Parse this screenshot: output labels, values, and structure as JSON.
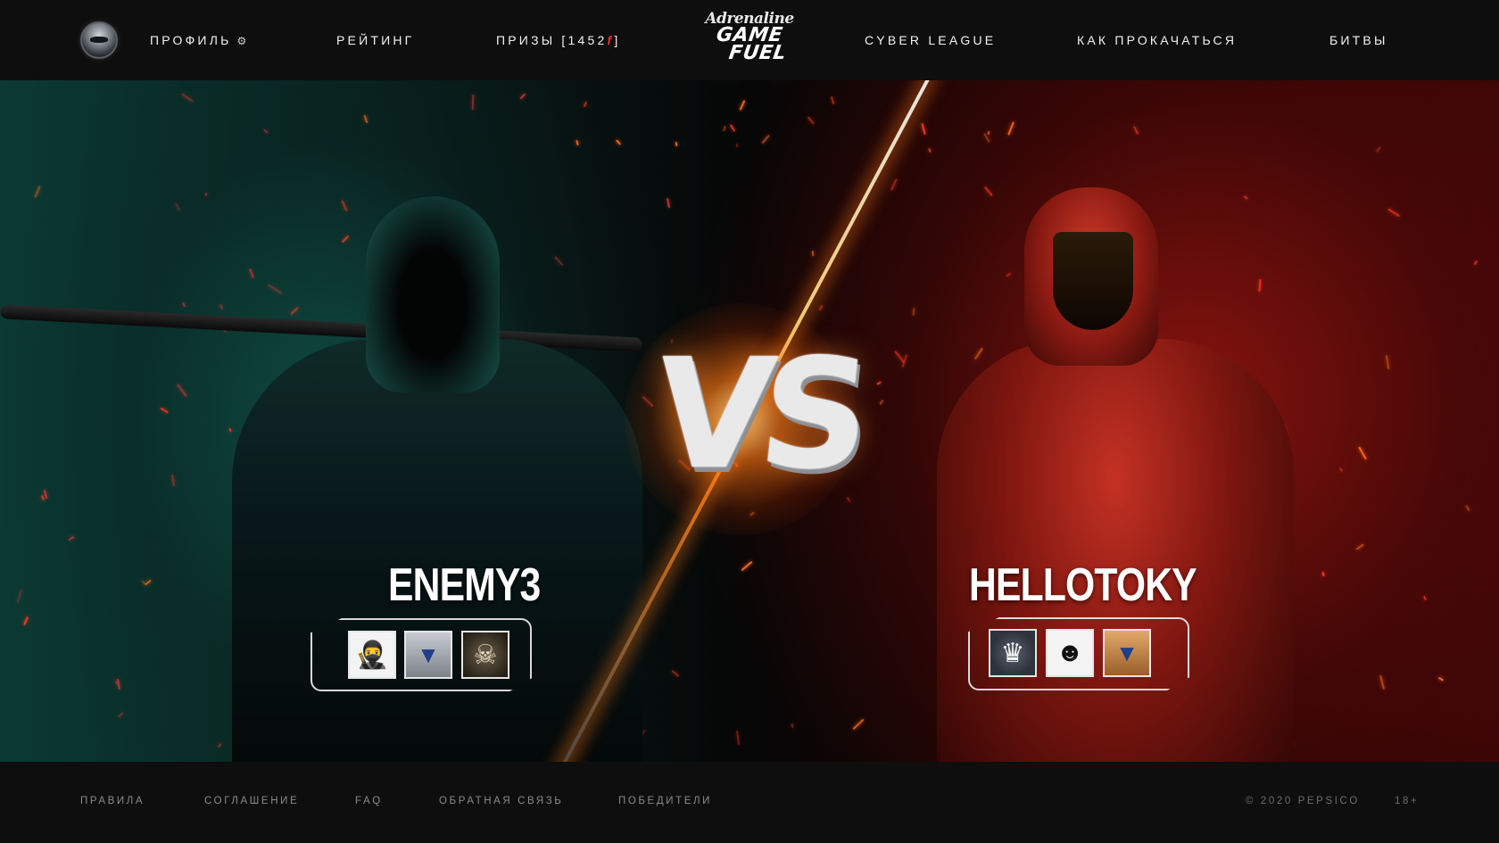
{
  "header": {
    "profile_label": "ПРОФИЛЬ",
    "rating_label": "РЕЙТИНГ",
    "prizes_label": "ПРИЗЫ [1452",
    "prizes_currency": "f",
    "prizes_close": "]",
    "logo_top": "Adrenaline",
    "logo_line1": "GAME",
    "logo_line2": "FUEL",
    "cyber_league_label": "CYBER LEAGUE",
    "howto_label": "КАК ПРОКАЧАТЬСЯ",
    "battles_label": "БИТВЫ"
  },
  "battle": {
    "vs_text": "VS",
    "left_player": {
      "name": "ENEMY3",
      "badges": [
        "hood-icon",
        "elite-icon",
        "skull-icon"
      ]
    },
    "right_player": {
      "name": "HELLOTOKY",
      "badges": [
        "crown-icon",
        "robot-icon",
        "elite-gold-icon"
      ]
    }
  },
  "footer": {
    "rules": "ПРАВИЛА",
    "agreement": "СОГЛАШЕНИЕ",
    "faq": "FAQ",
    "feedback": "ОБРАТНАЯ СВЯЗЬ",
    "winners": "ПОБЕДИТЕЛИ",
    "copyright": "© 2020 PEPSICO",
    "age": "18+"
  },
  "colors": {
    "accent_red": "#ff2a2a",
    "left_glow": "#0b3a33",
    "right_glow": "#3a0606"
  }
}
